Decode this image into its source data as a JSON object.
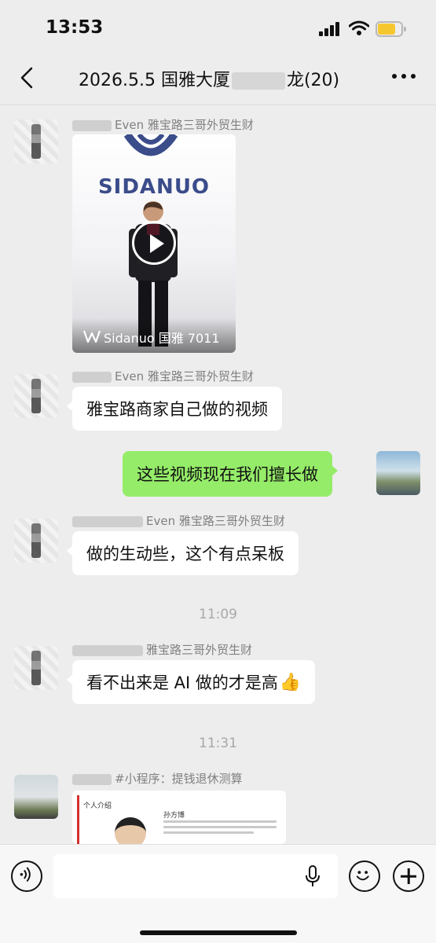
{
  "status_bar": {
    "time": "13:53"
  },
  "header": {
    "title_prefix": "2026.5.5 国雅大厦",
    "title_suffix": "龙(20)"
  },
  "messages": [
    {
      "sender": "Even 雅宝路三哥外贸生财",
      "type": "video",
      "channel_name": "Sidanuo 国雅 7011",
      "brand": "SIDANUO"
    },
    {
      "sender": "Even 雅宝路三哥外贸生财",
      "text": "雅宝路商家自己做的视频"
    },
    {
      "mine": true,
      "text": "这些视频现在我们擅长做"
    },
    {
      "sender": "Even 雅宝路三哥外贸生财",
      "text": "做的生动些，这个有点呆板"
    },
    {
      "timestamp": "11:09"
    },
    {
      "sender": "雅宝路三哥外贸生财",
      "text": "看不出来是 AI 做的才是高",
      "emoji": "👍"
    },
    {
      "timestamp": "11:31"
    },
    {
      "sender": "#小程序：提钱退休测算",
      "type": "mini-program",
      "card_label": "个人介绍",
      "card_name": "孙方博"
    }
  ]
}
